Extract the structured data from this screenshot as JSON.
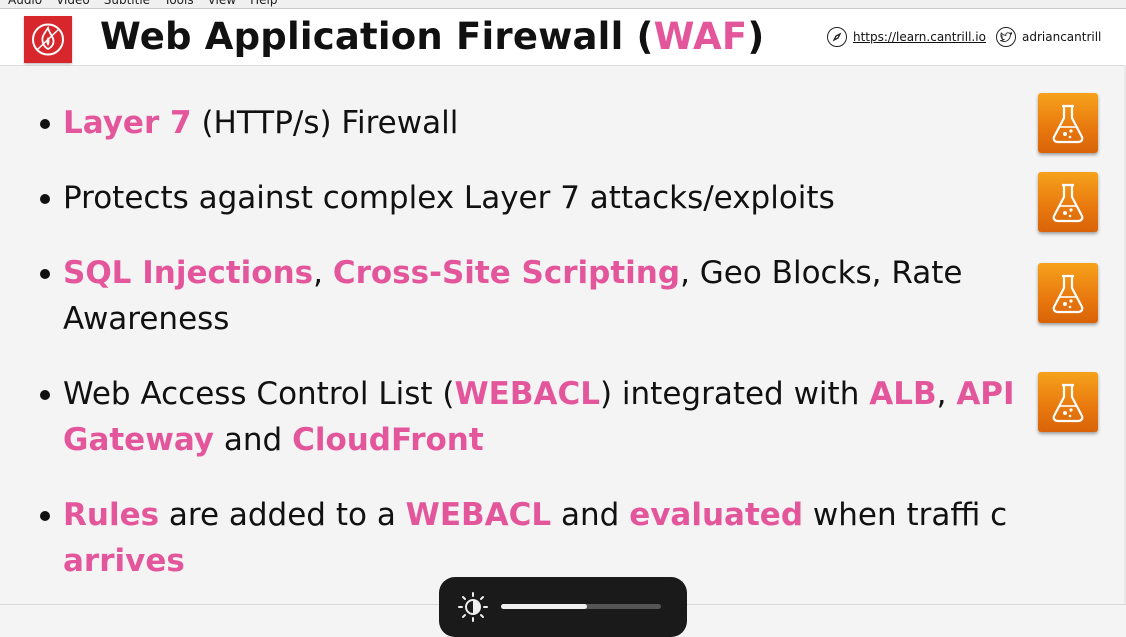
{
  "menubar": {
    "items": [
      "Audio",
      "Video",
      "Subtitle",
      "Tools",
      "View",
      "Help"
    ]
  },
  "header": {
    "logo_icon": "firewall-shield-icon",
    "title_prefix": "Web Application Firewall (",
    "title_highlight": "WAF",
    "title_suffix": ")",
    "website": "https://learn.cantrill.io",
    "website_icon": "compass-icon",
    "twitter": "adriancantrill",
    "twitter_icon": "twitter-icon"
  },
  "bullets": [
    {
      "parts": [
        {
          "t": "Layer 7",
          "h": true
        },
        {
          "t": " (HTTP/s) Firewall",
          "h": false
        }
      ]
    },
    {
      "parts": [
        {
          "t": "Protects against complex Layer 7 attacks/exploits",
          "h": false
        }
      ]
    },
    {
      "parts": [
        {
          "t": "SQL Injections",
          "h": true
        },
        {
          "t": ", ",
          "h": false
        },
        {
          "t": "Cross-Site Scripting",
          "h": true
        },
        {
          "t": ", Geo Blocks, Rate Awareness",
          "h": false
        }
      ]
    },
    {
      "parts": [
        {
          "t": "Web Access Control List (",
          "h": false
        },
        {
          "t": "WEBACL",
          "h": true
        },
        {
          "t": ") integrated with ",
          "h": false
        },
        {
          "t": "ALB",
          "h": true
        },
        {
          "t": ", ",
          "h": false
        },
        {
          "t": "API Gateway",
          "h": true
        },
        {
          "t": " and ",
          "h": false
        },
        {
          "t": "CloudFront",
          "h": true
        }
      ]
    },
    {
      "parts": [
        {
          "t": "Rules",
          "h": true
        },
        {
          "t": " are added to a ",
          "h": false
        },
        {
          "t": "WEBACL",
          "h": true
        },
        {
          "t": " and ",
          "h": false
        },
        {
          "t": "evaluated",
          "h": true
        },
        {
          "t": " when traffi c ",
          "h": false
        },
        {
          "t": "arrives",
          "h": true
        }
      ]
    }
  ],
  "lab_icon": "lab-flask-icon",
  "brightness_osd": {
    "icon": "brightness-icon",
    "level": 0.54
  },
  "colors": {
    "accent": "#e4569b",
    "logo_red": "#d8262d",
    "lab_orange": "#f39a1b"
  }
}
